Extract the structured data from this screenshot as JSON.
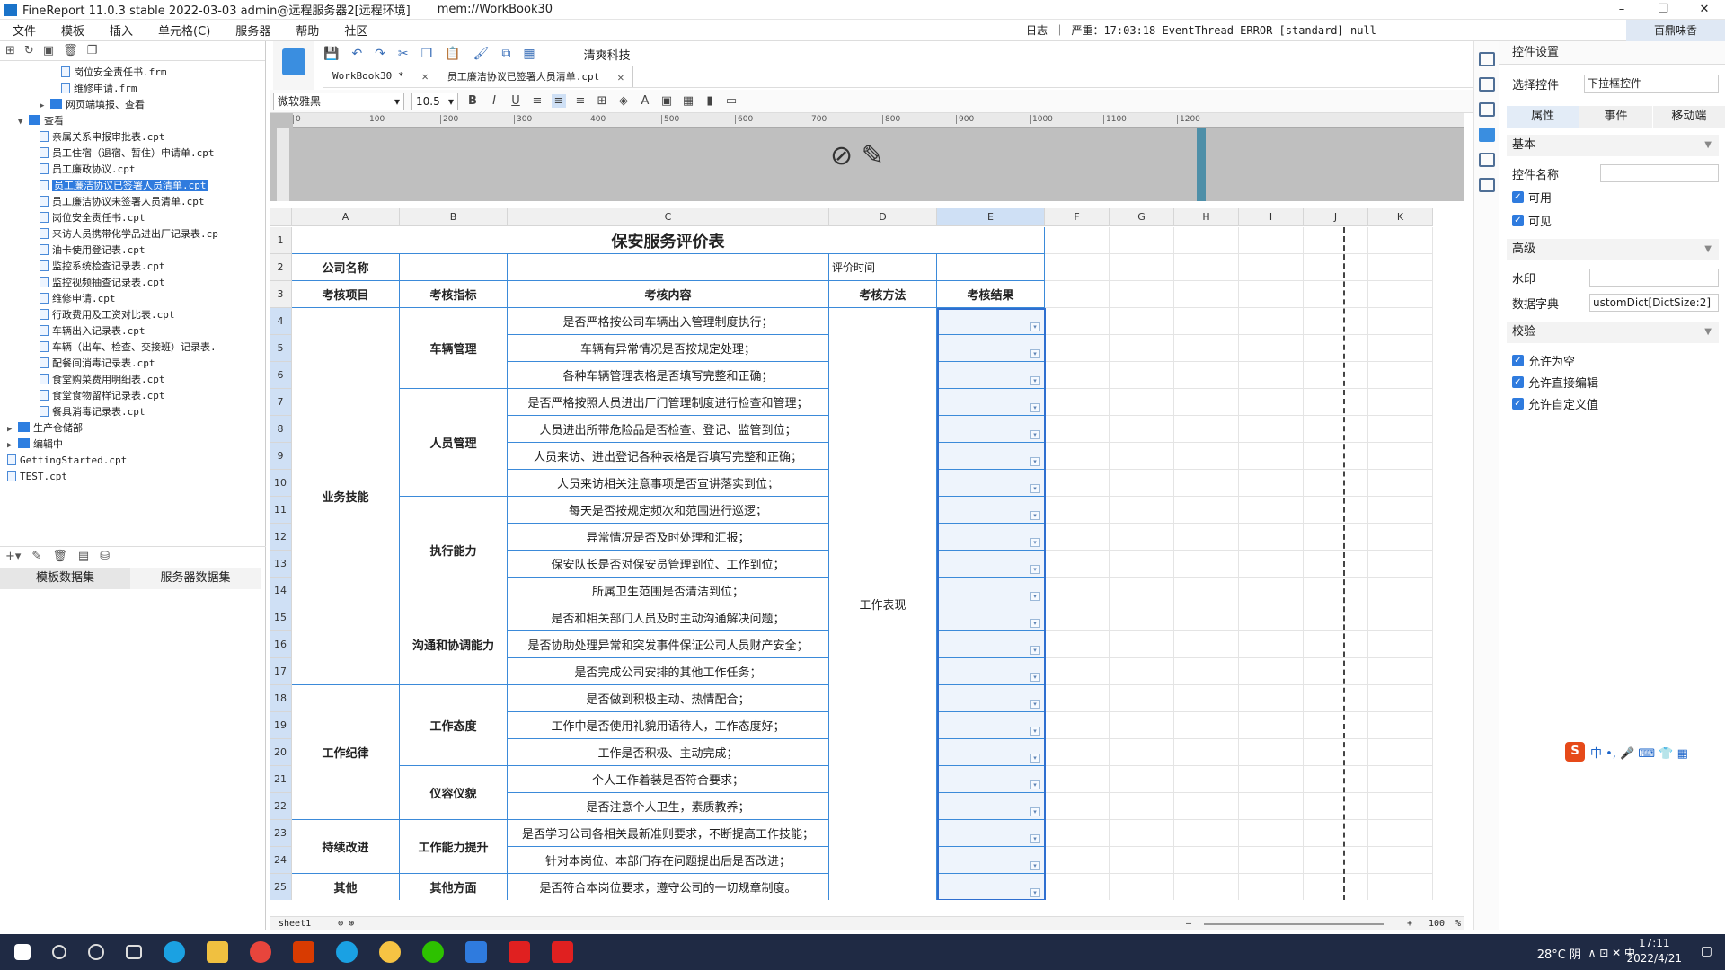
{
  "window": {
    "title": "FineReport 11.0.3 stable 2022-03-03 admin@远程服务器2[远程环境]",
    "path": "mem://WorkBook30",
    "min": "–",
    "max": "❐",
    "close": "✕"
  },
  "menu": {
    "items": [
      "文件",
      "模板",
      "插入",
      "单元格(C)",
      "服务器",
      "帮助",
      "社区"
    ],
    "log": "日志 ｜ 严重：17:03:18 EventThread ERROR [standard] null",
    "account": "百鼎味香"
  },
  "tree": {
    "items": [
      {
        "d": 5,
        "t": "岗位安全责任书.frm",
        "k": "f"
      },
      {
        "d": 5,
        "t": "维修申请.frm",
        "k": "f"
      },
      {
        "d": 3,
        "t": "网页端填报、查看",
        "k": "d",
        "a": "▶"
      },
      {
        "d": 1,
        "t": "查看",
        "k": "d",
        "a": "▼"
      },
      {
        "d": 3,
        "t": "亲属关系申报审批表.cpt",
        "k": "f"
      },
      {
        "d": 3,
        "t": "员工住宿（退宿、暂住）申请单.cpt",
        "k": "f"
      },
      {
        "d": 3,
        "t": "员工廉政协议.cpt",
        "k": "f"
      },
      {
        "d": 3,
        "t": "员工廉洁协议已签署人员清单.cpt",
        "k": "f",
        "s": true
      },
      {
        "d": 3,
        "t": "员工廉洁协议未签署人员清单.cpt",
        "k": "f"
      },
      {
        "d": 3,
        "t": "岗位安全责任书.cpt",
        "k": "f"
      },
      {
        "d": 3,
        "t": "来访人员携带化学品进出厂记录表.cp",
        "k": "f"
      },
      {
        "d": 3,
        "t": "油卡使用登记表.cpt",
        "k": "f"
      },
      {
        "d": 3,
        "t": "监控系统检查记录表.cpt",
        "k": "f"
      },
      {
        "d": 3,
        "t": "监控视频抽查记录表.cpt",
        "k": "f"
      },
      {
        "d": 3,
        "t": "维修申请.cpt",
        "k": "f"
      },
      {
        "d": 3,
        "t": "行政费用及工资对比表.cpt",
        "k": "f"
      },
      {
        "d": 3,
        "t": "车辆出入记录表.cpt",
        "k": "f"
      },
      {
        "d": 3,
        "t": "车辆（出车、检查、交接班）记录表.",
        "k": "f"
      },
      {
        "d": 3,
        "t": "配餐间消毒记录表.cpt",
        "k": "f"
      },
      {
        "d": 3,
        "t": "食堂购菜费用明细表.cpt",
        "k": "f"
      },
      {
        "d": 3,
        "t": "食堂食物留样记录表.cpt",
        "k": "f"
      },
      {
        "d": 3,
        "t": "餐具消毒记录表.cpt",
        "k": "f"
      },
      {
        "d": 0,
        "t": "生产仓储部",
        "k": "d",
        "a": "▶"
      },
      {
        "d": 0,
        "t": "编辑中",
        "k": "d",
        "a": "▶"
      },
      {
        "d": 0,
        "t": "GettingStarted.cpt",
        "k": "f"
      },
      {
        "d": 0,
        "t": "TEST.cpt",
        "k": "f"
      }
    ]
  },
  "dataset_tabs": {
    "template": "模板数据集",
    "server": "服务器数据集"
  },
  "toolbar": {
    "brand": "清爽科技"
  },
  "tabs": {
    "t1": "WorkBook30 *",
    "t2": "员工廉洁协议已签署人员清单.cpt",
    "close": "✕"
  },
  "format": {
    "font": "微软雅黑",
    "size": "10.5",
    "bold": "B",
    "italic": "I",
    "underline": "U"
  },
  "ruler": {
    "ticks": [
      "0",
      "100",
      "200",
      "300",
      "400",
      "500",
      "600",
      "700",
      "800",
      "900",
      "1000",
      "1100",
      "1200"
    ]
  },
  "sheet": {
    "cols": [
      "A",
      "B",
      "C",
      "D",
      "E",
      "F",
      "G",
      "H",
      "I",
      "J",
      "K"
    ],
    "rows": [
      "1",
      "2",
      "3",
      "4",
      "5",
      "6",
      "7",
      "8",
      "9",
      "10",
      "11",
      "12",
      "13",
      "14",
      "15",
      "16",
      "17",
      "18",
      "19",
      "20",
      "21",
      "22",
      "23",
      "24",
      "25"
    ],
    "title": "保安服务评价表",
    "company_label": "公司名称",
    "time_label": "评价时间",
    "headers": [
      "考核项目",
      "考核指标",
      "考核内容",
      "考核方法",
      "考核结果"
    ],
    "groupA": [
      "业务技能",
      "工作纪律",
      "持续改进",
      "其他"
    ],
    "groupB": [
      "车辆管理",
      "人员管理",
      "执行能力",
      "沟通和协调能力",
      "工作态度",
      "仪容仪貌",
      "工作能力提升",
      "其他方面"
    ],
    "method": "工作表现",
    "content": [
      "是否严格按公司车辆出入管理制度执行；",
      "车辆有异常情况是否按规定处理；",
      "各种车辆管理表格是否填写完整和正确；",
      "是否严格按照人员进出厂门管理制度进行检查和管理；",
      "人员进出所带危险品是否检查、登记、监管到位；",
      "人员来访、进出登记各种表格是否填写完整和正确；",
      "人员来访相关注意事项是否宣讲落实到位；",
      "每天是否按规定频次和范围进行巡逻；",
      "异常情况是否及时处理和汇报；",
      "保安队长是否对保安员管理到位、工作到位；",
      "所属卫生范围是否清洁到位；",
      "是否和相关部门人员及时主动沟通解决问题；",
      "是否协助处理异常和突发事件保证公司人员财产安全；",
      "是否完成公司安排的其他工作任务；",
      "是否做到积极主动、热情配合；",
      "工作中是否使用礼貌用语待人，工作态度好；",
      "工作是否积极、主动完成；",
      "个人工作着装是否符合要求；",
      "是否注意个人卫生，素质教养；",
      "是否学习公司各相关最新准则要求，不断提高工作技能；",
      "针对本岗位、本部门存在问题提出后是否改进；",
      "是否符合本岗位要求，遵守公司的一切规章制度。"
    ]
  },
  "bottom": {
    "sheet": "sheet1",
    "zoom": "100",
    "pct": "%",
    "minus": "–",
    "plus": "+"
  },
  "right": {
    "title": "控件设置",
    "choose_label": "选择控件",
    "choose_value": "下拉框控件",
    "tabs": [
      "属性",
      "事件",
      "移动端"
    ],
    "basic": "基本",
    "name_label": "控件名称",
    "enabled": "可用",
    "visible": "可见",
    "advanced": "高级",
    "watermark": "水印",
    "dict_label": "数据字典",
    "dict_value": "ustomDict[DictSize:2]",
    "validation": "校验",
    "allow_empty": "允许为空",
    "allow_edit": "允许直接编辑",
    "allow_custom": "允许自定义值"
  },
  "ime": {
    "label": "中 •, 🎤 ⌨ 👕 ▦"
  },
  "taskbar": {
    "weather": "28°C 阴",
    "time": "17:11",
    "date": "2022/4/21",
    "sys": "∧ ⊡ ✕ 中"
  }
}
